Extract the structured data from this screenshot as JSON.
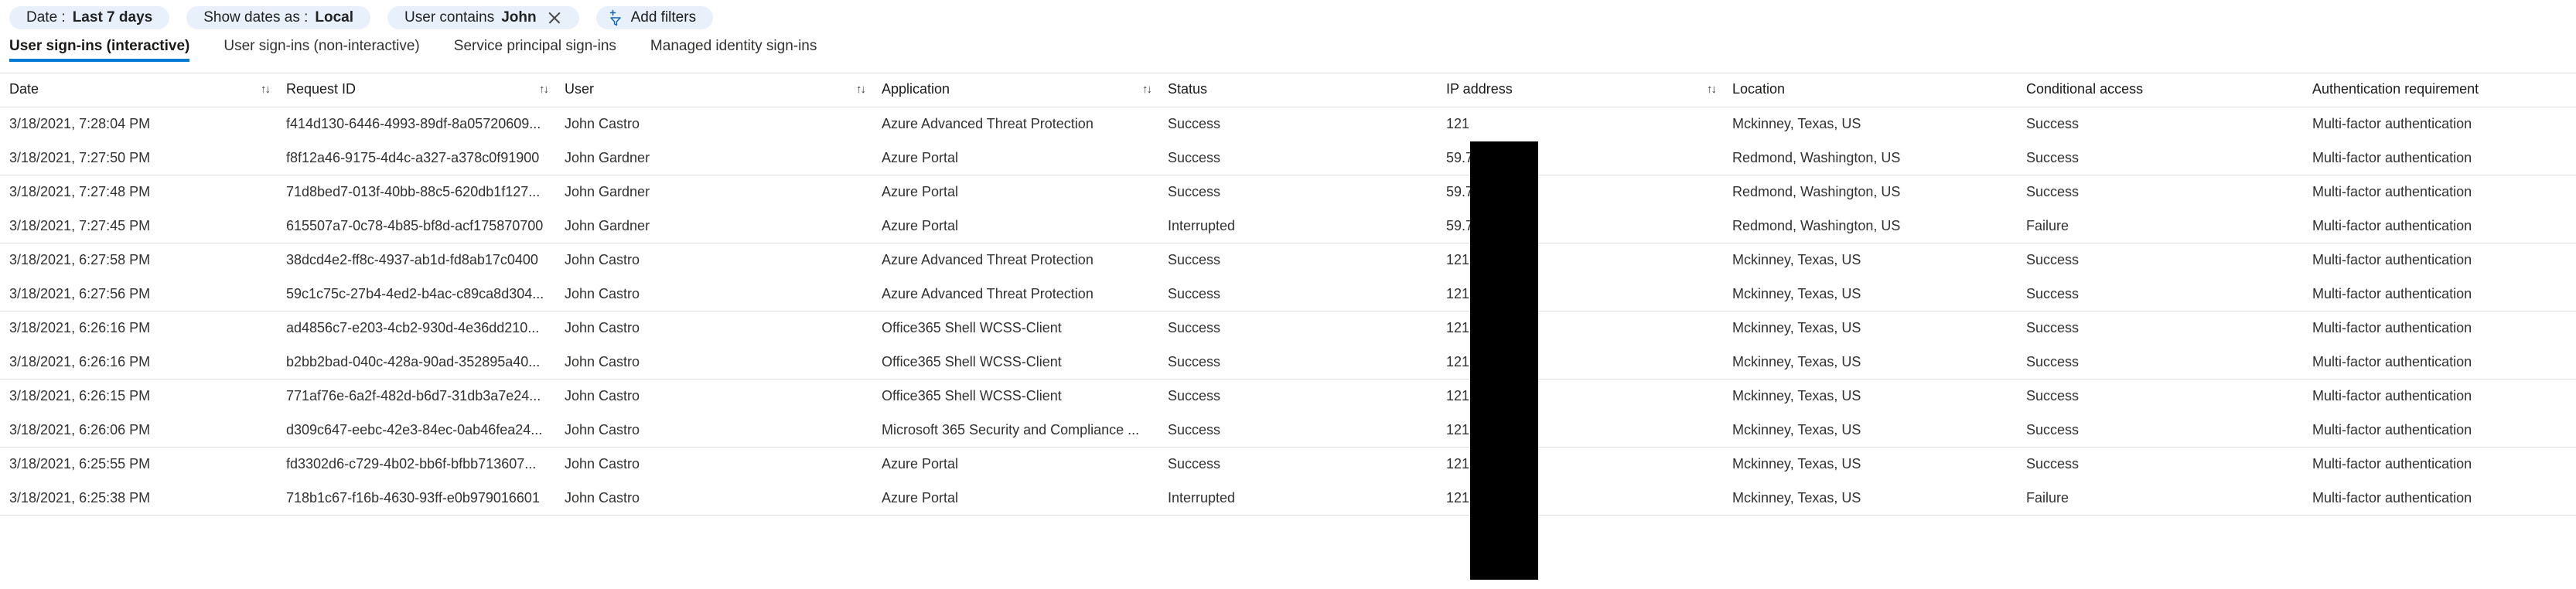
{
  "filters": [
    {
      "id": "date",
      "name": "filter-pill-date",
      "lead": "Date :",
      "value": "Last 7 days",
      "removable": false
    },
    {
      "id": "show_dates_as",
      "name": "filter-pill-show-dates-as",
      "lead": "Show dates as :",
      "value": "Local",
      "removable": false
    },
    {
      "id": "user_contains",
      "name": "filter-pill-user-contains",
      "lead": "User contains",
      "value": "John",
      "removable": true
    }
  ],
  "add_filters": {
    "label": "Add filters",
    "icon": "add-filter-funnel-icon"
  },
  "tabs": [
    {
      "label": "User sign-ins (interactive)",
      "active": true
    },
    {
      "label": "User sign-ins (non-interactive)",
      "active": false
    },
    {
      "label": "Service principal sign-ins",
      "active": false
    },
    {
      "label": "Managed identity sign-ins",
      "active": false
    }
  ],
  "table": {
    "columns": [
      {
        "key": "date",
        "label": "Date",
        "sortable": true
      },
      {
        "key": "request_id",
        "label": "Request ID",
        "sortable": true
      },
      {
        "key": "user",
        "label": "User",
        "sortable": true
      },
      {
        "key": "application",
        "label": "Application",
        "sortable": true
      },
      {
        "key": "status",
        "label": "Status",
        "sortable": false
      },
      {
        "key": "ip_address",
        "label": "IP address",
        "sortable": true
      },
      {
        "key": "location",
        "label": "Location",
        "sortable": false
      },
      {
        "key": "conditional_access",
        "label": "Conditional access",
        "sortable": false
      },
      {
        "key": "authentication_requirement",
        "label": "Authentication requirement",
        "sortable": false
      }
    ],
    "rows": [
      {
        "date": "3/18/2021, 7:28:04 PM",
        "request_id": "f414d130-6446-4993-89df-8a05720609...",
        "user": "John Castro",
        "application": "Azure Advanced Threat Protection",
        "status": "Success",
        "ip_address": "121",
        "location": "Mckinney, Texas, US",
        "conditional_access": "Success",
        "authentication_requirement": "Multi-factor authentication"
      },
      {
        "date": "3/18/2021, 7:27:50 PM",
        "request_id": "f8f12a46-9175-4d4c-a327-a378c0f91900",
        "user": "John Gardner",
        "application": "Azure Portal",
        "status": "Success",
        "ip_address": "59.79",
        "location": "Redmond, Washington, US",
        "conditional_access": "Success",
        "authentication_requirement": "Multi-factor authentication"
      },
      {
        "date": "3/18/2021, 7:27:48 PM",
        "request_id": "71d8bed7-013f-40bb-88c5-620db1f127...",
        "user": "John Gardner",
        "application": "Azure Portal",
        "status": "Success",
        "ip_address": "59.79",
        "location": "Redmond, Washington, US",
        "conditional_access": "Success",
        "authentication_requirement": "Multi-factor authentication"
      },
      {
        "date": "3/18/2021, 7:27:45 PM",
        "request_id": "615507a7-0c78-4b85-bf8d-acf175870700",
        "user": "John Gardner",
        "application": "Azure Portal",
        "status": "Interrupted",
        "ip_address": "59.79",
        "location": "Redmond, Washington, US",
        "conditional_access": "Failure",
        "authentication_requirement": "Multi-factor authentication"
      },
      {
        "date": "3/18/2021, 6:27:58 PM",
        "request_id": "38dcd4e2-ff8c-4937-ab1d-fd8ab17c0400",
        "user": "John Castro",
        "application": "Azure Advanced Threat Protection",
        "status": "Success",
        "ip_address": "121",
        "location": "Mckinney, Texas, US",
        "conditional_access": "Success",
        "authentication_requirement": "Multi-factor authentication"
      },
      {
        "date": "3/18/2021, 6:27:56 PM",
        "request_id": "59c1c75c-27b4-4ed2-b4ac-c89ca8d304...",
        "user": "John Castro",
        "application": "Azure Advanced Threat Protection",
        "status": "Success",
        "ip_address": "121",
        "location": "Mckinney, Texas, US",
        "conditional_access": "Success",
        "authentication_requirement": "Multi-factor authentication"
      },
      {
        "date": "3/18/2021, 6:26:16 PM",
        "request_id": "ad4856c7-e203-4cb2-930d-4e36dd210...",
        "user": "John Castro",
        "application": "Office365 Shell WCSS-Client",
        "status": "Success",
        "ip_address": "121",
        "location": "Mckinney, Texas, US",
        "conditional_access": "Success",
        "authentication_requirement": "Multi-factor authentication"
      },
      {
        "date": "3/18/2021, 6:26:16 PM",
        "request_id": "b2bb2bad-040c-428a-90ad-352895a40...",
        "user": "John Castro",
        "application": "Office365 Shell WCSS-Client",
        "status": "Success",
        "ip_address": "121",
        "location": "Mckinney, Texas, US",
        "conditional_access": "Success",
        "authentication_requirement": "Multi-factor authentication"
      },
      {
        "date": "3/18/2021, 6:26:15 PM",
        "request_id": "771af76e-6a2f-482d-b6d7-31db3a7e24...",
        "user": "John Castro",
        "application": "Office365 Shell WCSS-Client",
        "status": "Success",
        "ip_address": "121",
        "location": "Mckinney, Texas, US",
        "conditional_access": "Success",
        "authentication_requirement": "Multi-factor authentication"
      },
      {
        "date": "3/18/2021, 6:26:06 PM",
        "request_id": "d309c647-eebc-42e3-84ec-0ab46fea24...",
        "user": "John Castro",
        "application": "Microsoft 365 Security and Compliance ...",
        "status": "Success",
        "ip_address": "121",
        "location": "Mckinney, Texas, US",
        "conditional_access": "Success",
        "authentication_requirement": "Multi-factor authentication"
      },
      {
        "date": "3/18/2021, 6:25:55 PM",
        "request_id": "fd3302d6-c729-4b02-bb6f-bfbb713607...",
        "user": "John Castro",
        "application": "Azure Portal",
        "status": "Success",
        "ip_address": "121",
        "location": "Mckinney, Texas, US",
        "conditional_access": "Success",
        "authentication_requirement": "Multi-factor authentication"
      },
      {
        "date": "3/18/2021, 6:25:38 PM",
        "request_id": "718b1c67-f16b-4630-93ff-e0b979016601",
        "user": "John Castro",
        "application": "Azure Portal",
        "status": "Interrupted",
        "ip_address": "121",
        "location": "Mckinney, Texas, US",
        "conditional_access": "Failure",
        "authentication_requirement": "Multi-factor authentication"
      }
    ]
  },
  "redaction": {
    "name": "ip-address-redaction-box",
    "color": "#000000"
  },
  "colors": {
    "accent": "#0078d4",
    "pill_bg": "#e8f1fb",
    "row_divider": "#e1dfdd"
  },
  "icons": {
    "sort": "↑↓"
  }
}
